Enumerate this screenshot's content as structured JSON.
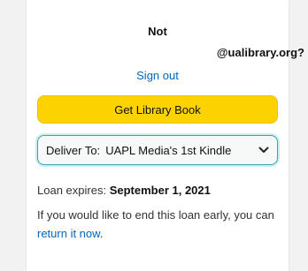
{
  "account": {
    "line1": "Not",
    "line2": "@ualibrary.org?",
    "sign_out_label": "Sign out"
  },
  "actions": {
    "get_book_label": "Get Library Book"
  },
  "deliver": {
    "label": "Deliver To:",
    "selected_device": "UAPL Media's 1st Kindle",
    "chevron_icon": "chevron-down-icon"
  },
  "loan": {
    "expires_label": "Loan expires:",
    "expires_date": "September 1, 2021",
    "end_text_before": "If you would like to end this loan early, you can ",
    "return_link": "return it now",
    "end_text_after": "."
  },
  "colors": {
    "button_yellow": "#fcd200",
    "link_blue": "#0066c0",
    "select_focus_border": "#3aa6ad"
  }
}
